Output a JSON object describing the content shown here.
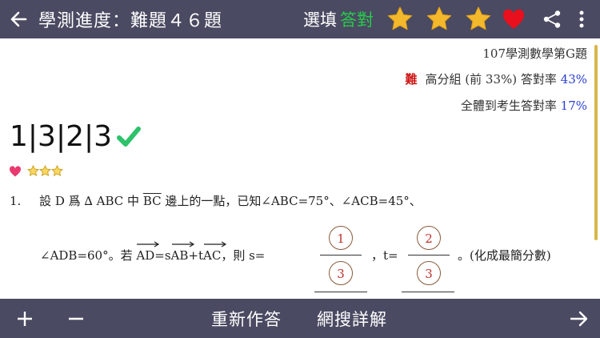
{
  "topbar": {
    "title": "學測進度：難題４６題",
    "mode_label": "選填",
    "mode_value": "答對",
    "colors": {
      "bar": "#4a4a62",
      "accent_green": "#28c94a",
      "star": "#f4b82c",
      "heart": "#e8101c"
    },
    "icons": [
      "back-arrow-icon",
      "star-icon",
      "star-icon",
      "star-icon",
      "heart-icon",
      "share-icon",
      "more-vert-icon"
    ]
  },
  "info": {
    "source": "107學測數學第G題",
    "difficulty": "難",
    "top_group_label": "高分組 (前 33%) 答對率",
    "top_group_rate": "43%",
    "all_label": "全體到考生答對率",
    "all_rate": "17%"
  },
  "answer": {
    "digits": "1|3|2|3",
    "status_icon": "checkmark-icon",
    "status_color": "#2ec26a"
  },
  "badges": {
    "heart": "heart-icon",
    "stars": 3
  },
  "question": {
    "number": "1.",
    "line1_a": "設 D 爲 ∆ ABC 中",
    "bc": "BC",
    "line1_b": "邊上的一點，已知∠ABC=75°、∠ACB=45°、",
    "line2_a": "∠ADB=60°。若",
    "ad": "AD",
    "eq1": "=s",
    "ab": "AB",
    "plus": "+t",
    "ac": "AC",
    "then": "，則 s=",
    "s_num": "1",
    "s_den": "3",
    "t_label": "，t=",
    "t_num": "2",
    "t_den": "3",
    "tail": "。(化成最簡分數)"
  },
  "bottombar": {
    "plus": "+",
    "minus": "−",
    "retry": "重新作答",
    "search": "網搜詳解",
    "next_icon": "arrow-right-icon"
  }
}
